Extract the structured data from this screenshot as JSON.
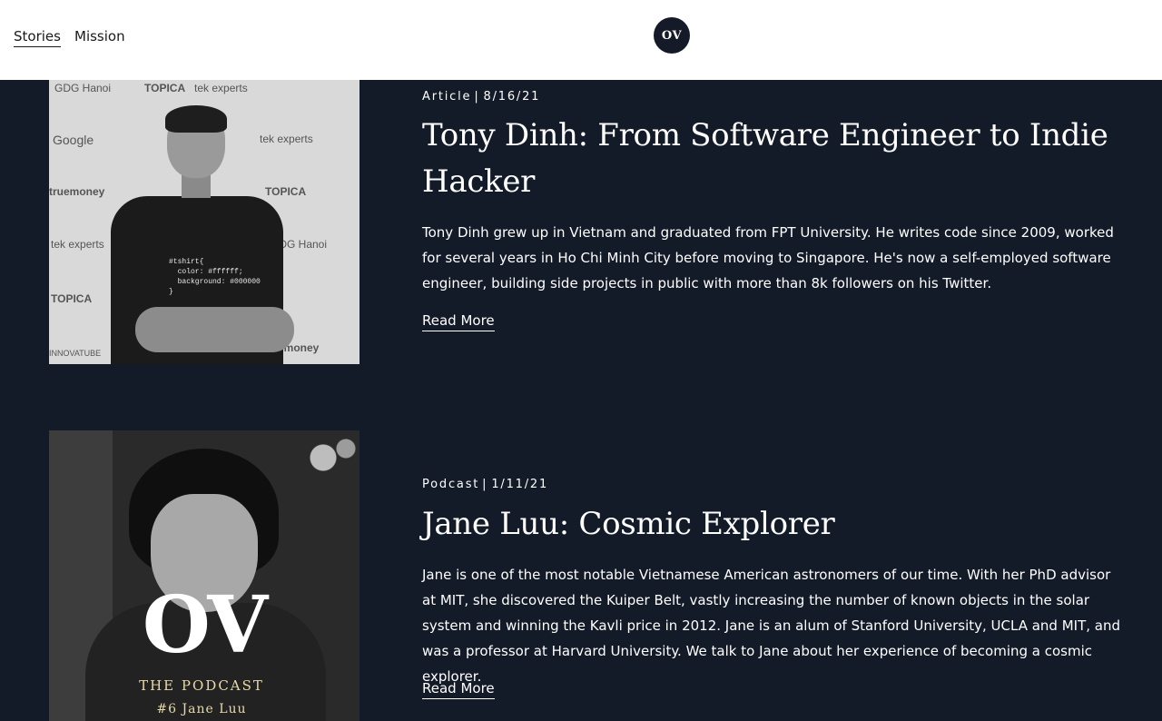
{
  "header": {
    "nav": [
      {
        "label": "Stories"
      },
      {
        "label": "Mission"
      }
    ],
    "logo_text": "OV"
  },
  "stories": [
    {
      "type": "Article",
      "date": "8/16/21",
      "title": "Tony Dinh: From Software Engineer to Indie Hacker",
      "description": "Tony Dinh grew up in Vietnam and graduated from FPT University. He writes code since 2009, worked for several years in Ho Chi Minh City before moving to Singapore. He's now a self-employed software engineer, building side projects in public with more than 8k followers on his Twitter.",
      "read_more": "Read More",
      "image": {
        "sponsors": [
          "GDG Hanoi",
          "TOPICA",
          "tek experts",
          "Google",
          "truemoney",
          "INNOVATUBE"
        ],
        "shirt_text": "#tshirt{\n  color: #ffffff;\n  background: #000000\n}"
      }
    },
    {
      "type": "Podcast",
      "date": "1/11/21",
      "title": "Jane Luu: Cosmic Explorer",
      "description": "Jane is one of the most notable Vietnamese American astronomers of our time. With her PhD advisor at MIT, she discovered the Kuiper Belt, vastly increasing the number of known objects in the solar system and winning the Kavli price in 2012. Jane is an alum of Stanford University, UCLA and MIT, and was a professor at Harvard University. We talk to Jane about her experience of becoming a cosmic explorer.",
      "read_more": "Read More",
      "image": {
        "cover_title": "OV",
        "cover_subtitle": "THE PODCAST",
        "cover_episode": "#6  Jane Luu"
      }
    }
  ],
  "colors": {
    "background": "#131a28",
    "header": "#ffffff",
    "text": "#ffffff",
    "podcast_accent": "#e8d9a8"
  }
}
